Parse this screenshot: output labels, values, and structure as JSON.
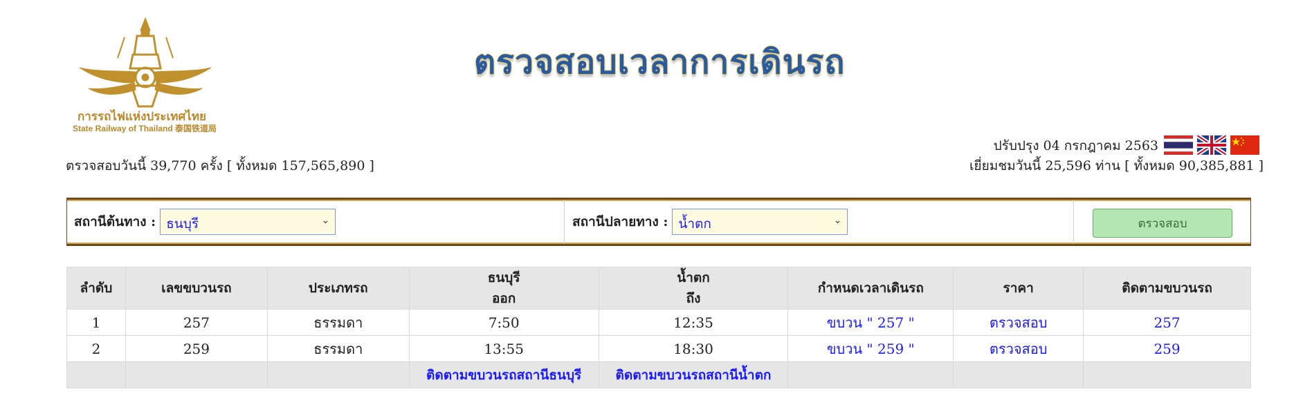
{
  "logo": {
    "text_th": "การรถไฟแห่งประเทศไทย",
    "text_en": "State Railway of Thailand 泰国铁道局"
  },
  "title": "ตรวจสอบเวลาการเดินรถ",
  "stats": {
    "today_checks": "ตรวจสอบวันนี้ 39,770 ครั้ง [ ทั้งหมด  157,565,890  ]",
    "updated": "ปรับปรุง 04 กรกฎาคม 2563",
    "visitors": "เยี่ยมชมวันนี้ 25,596 ท่าน [ ทั้งหมด  90,385,881 ]"
  },
  "flags": [
    "thai-flag-icon",
    "uk-flag-icon",
    "china-flag-icon"
  ],
  "form": {
    "origin_label": "สถานีต้นทาง :",
    "origin_value": "ธนบุรี",
    "destination_label": "สถานีปลายทาง :",
    "destination_value": "น้ำตก",
    "submit_label": "ตรวจสอบ"
  },
  "table": {
    "headers": {
      "no": "ลำดับ",
      "train_no": "เลขขบวนรถ",
      "type": "ประเภทรถ",
      "origin_station": "ธนบุรี",
      "origin_sub": "ออก",
      "dest_station": "น้ำตก",
      "dest_sub": "ถึง",
      "schedule": "กำหนดเวลาเดินรถ",
      "price": "ราคา",
      "track": "ติดตามขบวนรถ"
    },
    "rows": [
      {
        "no": "1",
        "train_no": "257",
        "type": "ธรรมดา",
        "depart": "7:50",
        "arrive": "12:35",
        "schedule": "ขบวน \" 257 \"",
        "price": "ตรวจสอบ",
        "track": "257"
      },
      {
        "no": "2",
        "train_no": "259",
        "type": "ธรรมดา",
        "depart": "13:55",
        "arrive": "18:30",
        "schedule": "ขบวน \" 259 \"",
        "price": "ตรวจสอบ",
        "track": "259"
      }
    ],
    "footer": {
      "track_origin": "ติดตามขบวนรถสถานีธนบุรี",
      "track_dest": "ติดตามขบวนรถสถานีน้ำตก"
    }
  },
  "colors": {
    "gold": "#b8892a",
    "link": "#1a1aff",
    "header_bg": "#e6e6e6",
    "button_bg": "#b3e6b0"
  }
}
